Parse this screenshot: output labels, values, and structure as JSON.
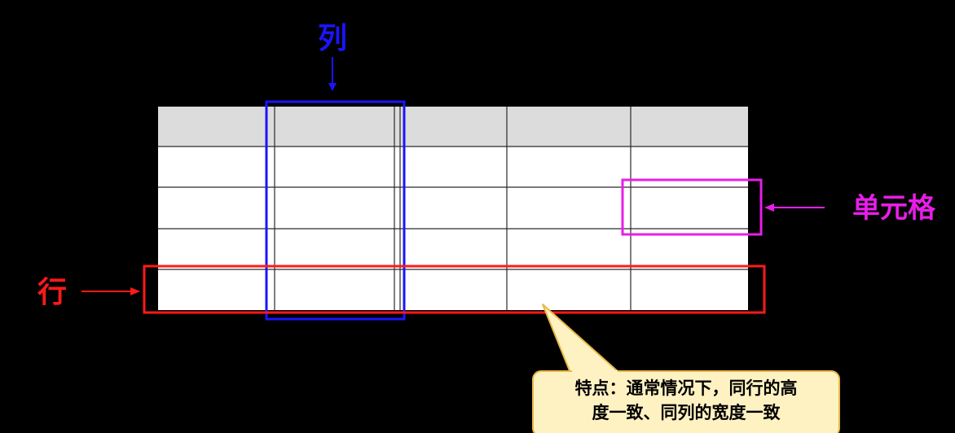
{
  "labels": {
    "column": "列",
    "cell": "单元格",
    "row": "行"
  },
  "callout": {
    "line1": "特点：通常情况下，同行的高",
    "line2": "度一致、同列的宽度一致"
  },
  "table": {
    "rows": 5,
    "columns": 5,
    "header_fill": "#dcdcdc",
    "body_fill": "#ffffff"
  },
  "colors": {
    "column_highlight": "#1a14ff",
    "cell_highlight": "#e81ee8",
    "row_highlight": "#ff1a1a",
    "callout_fill": "#fff2c2",
    "callout_border": "#e8b84a"
  }
}
